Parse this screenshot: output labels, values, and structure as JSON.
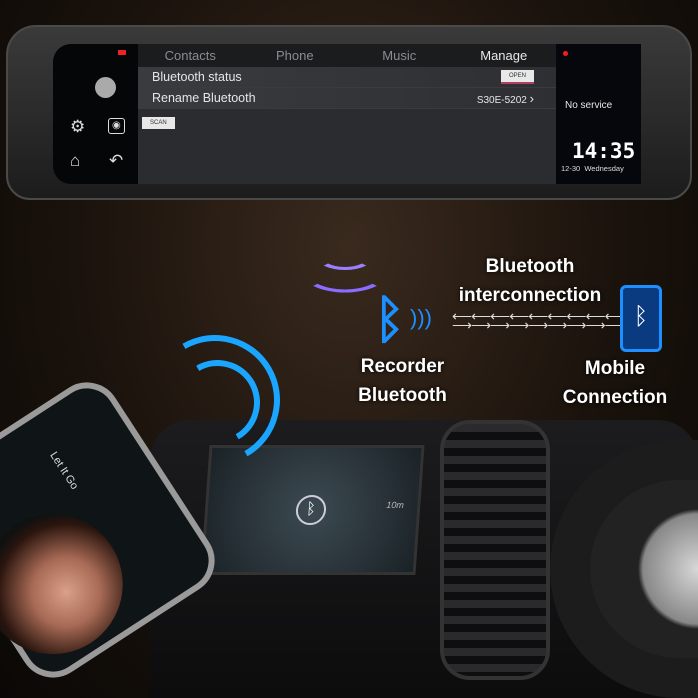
{
  "device": {
    "tabs": [
      {
        "label": "Contacts"
      },
      {
        "label": "Phone"
      },
      {
        "label": "Music"
      },
      {
        "label": "Manage",
        "active": true
      }
    ],
    "rows": [
      {
        "label": "Bluetooth status",
        "button": "OPEN"
      },
      {
        "label": "Rename Bluetooth",
        "value": "S30E-5202"
      }
    ],
    "scan_label": "SCAN",
    "side_icons": [
      "voice-icon",
      "settings-icon",
      "camera-icon",
      "home-icon",
      "back-icon"
    ],
    "status": "No service",
    "time": "14:35",
    "date": "12-30  Wednesday"
  },
  "captions": {
    "recorder_line1": "Recorder",
    "recorder_line2": "Bluetooth",
    "interconnect_line1": "Bluetooth",
    "interconnect_line2": "interconnection",
    "mobile_line1": "Mobile",
    "mobile_line2": "Connection"
  },
  "phone": {
    "song": "Let It Go"
  },
  "car_screen": {
    "distance": "10m"
  },
  "colors": {
    "bluetooth": "#1e8fff",
    "wave_purple": "#8a6cff",
    "wave_blue": "#1aa6ff",
    "indicator": "#ff1a1a"
  }
}
